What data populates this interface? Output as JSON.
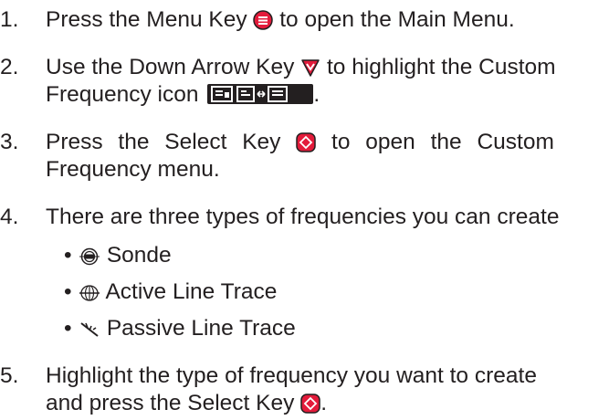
{
  "steps": [
    {
      "num": "1.",
      "before": "Press the Menu Key",
      "after": "to open the Main Menu.",
      "icon": "menu-key-icon"
    },
    {
      "num": "2.",
      "line1_before": "Use the Down Arrow Key",
      "line1_after": "to highlight the Custom",
      "line2": "Frequency icon",
      "line2_after": ".",
      "icons": [
        "down-arrow-key-icon",
        "custom-frequency-icon"
      ]
    },
    {
      "num": "3.",
      "line1_before": "Press the Select Key",
      "line1_after": "to open the Custom",
      "line2": "Frequency menu.",
      "icon": "select-key-icon"
    },
    {
      "num": "4.",
      "text": "There are three types of frequencies you can create"
    },
    {
      "num": "5.",
      "line1": "Highlight the type of frequency you want to create",
      "line2": "and press the Select Key",
      "line2_after": ".",
      "icon": "select-key-icon"
    }
  ],
  "frequency_types": [
    {
      "label": "Sonde",
      "icon": "sonde-icon"
    },
    {
      "label": "Active Line Trace",
      "icon": "active-line-trace-icon"
    },
    {
      "label": "Passive Line Trace",
      "icon": "passive-line-trace-icon"
    }
  ],
  "bullet": "•",
  "colors": {
    "text": "#231f20",
    "key_red": "#e31b3b"
  }
}
